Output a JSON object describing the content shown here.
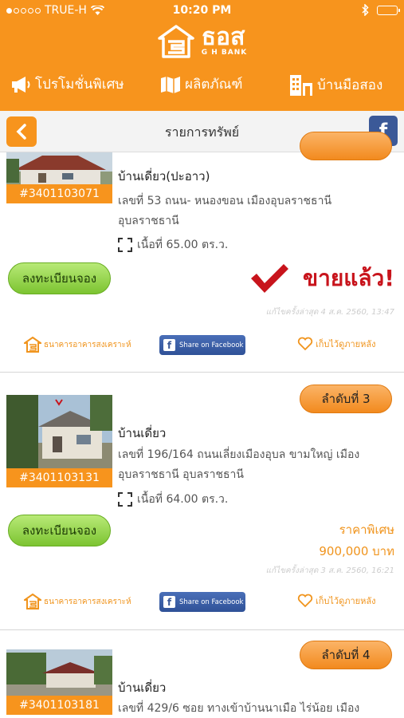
{
  "status_bar": {
    "carrier": "TRUE-H",
    "time": "10:20 PM",
    "icons": [
      "wifi-icon",
      "bluetooth-icon",
      "battery-icon"
    ]
  },
  "brand": {
    "name": "ธอส",
    "sub": "G H BANK"
  },
  "nav": {
    "promotion": "โปรโมชั่นพิเศษ",
    "products": "ผลิตภัณฑ์",
    "second_hand": "บ้านมือสอง"
  },
  "titlebar": {
    "title": "รายการทรัพย์",
    "facebook_label": "f"
  },
  "colors": {
    "brand_orange": "#f7941d",
    "sold_red": "#c8141c",
    "register_green": "#7cc431",
    "facebook_blue": "#3b5998"
  },
  "listings": [
    {
      "code": "#3401103071",
      "type": "บ้านเดี่ยว(ปะอาว)",
      "address_line1": "เลขที่ 53 ถนน- หนองขอน เมืองอุบลราชธานี",
      "address_line2": "อุบลราชธานี",
      "area": "เนื้อที่ 65.00 ตร.ว.",
      "register_label": "ลงทะเบียนจอง",
      "sold_label": "ขายแล้ว!",
      "updated": "แก้ไขครั้งล่าสุด 4 ส.ค. 2560, 13:47",
      "ghb_label": "ธนาคารอาคารสงเคราะห์",
      "share_label": "Share on Facebook",
      "save_label": "เก็บไว้ดูภายหลัง"
    },
    {
      "rank": "ลำดับที่ 3",
      "code": "#3401103131",
      "type": "บ้านเดี่ยว",
      "address_line1": "เลขที่ 196/164 ถนนเลี่ยงเมืองอุบล ขามใหญ่ เมือง",
      "address_line2": "อุบลราชธานี อุบลราชธานี",
      "area": "เนื้อที่ 64.00 ตร.ว.",
      "register_label": "ลงทะเบียนจอง",
      "special_label": "ราคาพิเศษ",
      "special_price": "900,000 บาท",
      "updated": "แก้ไขครั้งล่าสุด 3 ส.ค. 2560, 16:21",
      "ghb_label": "ธนาคารอาคารสงเคราะห์",
      "share_label": "Share on Facebook",
      "save_label": "เก็บไว้ดูภายหลัง"
    },
    {
      "rank": "ลำดับที่ 4",
      "code": "#3401103181",
      "type": "บ้านเดี่ยว",
      "address_line1": "เลขที่ 429/6 ซอย ทางเข้าบ้านนาเมือ ไร่น้อย เมือง"
    }
  ]
}
